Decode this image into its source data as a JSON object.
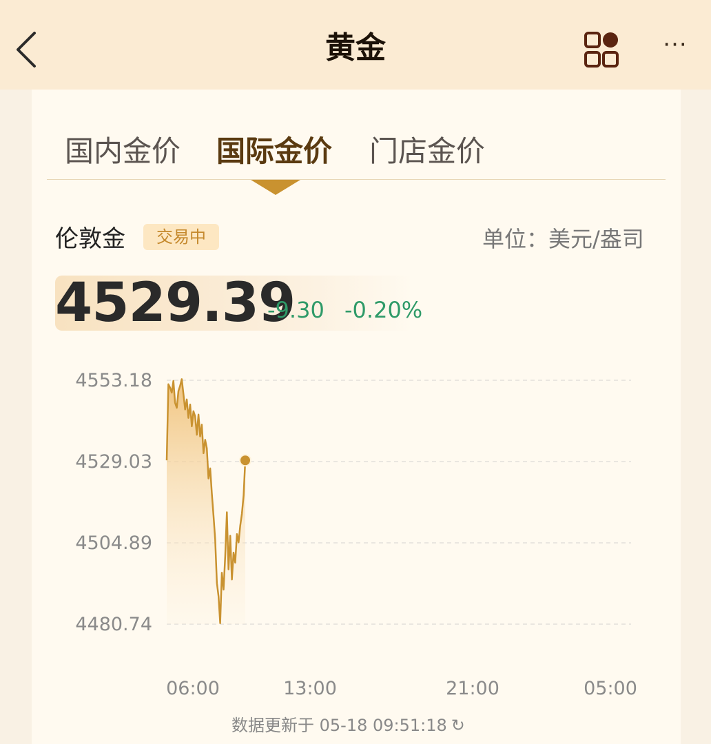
{
  "header": {
    "title": "黄金",
    "more_label": "···"
  },
  "tabs": [
    {
      "label": "国内金价",
      "active": false
    },
    {
      "label": "国际金价",
      "active": true
    },
    {
      "label": "门店金价",
      "active": false
    }
  ],
  "quote": {
    "name": "伦敦金",
    "status": "交易中",
    "unit": "单位：美元/盎司",
    "price": "4529.39",
    "change": "-9.30",
    "change_pct": "-0.20%"
  },
  "colors": {
    "accent": "#c99230",
    "down": "#2e9a68",
    "header_bg": "#fbebd3"
  },
  "footer": {
    "updated": "数据更新于 05-18 09:51:18",
    "refresh_icon": "refresh-icon"
  },
  "chart_data": {
    "type": "area",
    "y_ticks": [
      "4553.18",
      "4529.03",
      "4504.89",
      "4480.74"
    ],
    "x_ticks": [
      "06:00",
      "13:00",
      "21:00",
      "05:00"
    ],
    "ylim": [
      4480.74,
      4553.18
    ],
    "grid": true,
    "series": [
      {
        "values": [
          4529.4,
          4552.0,
          4551.0,
          4549.5,
          4553.0,
          4546.5,
          4545.0,
          4550.0,
          4551.5,
          4553.5,
          4549.0,
          4544.5,
          4547.5,
          4542.0,
          4546.0,
          4539.5,
          4544.0,
          4542.5,
          4537.0,
          4543.0,
          4536.5,
          4540.0,
          4531.5,
          4535.5,
          4533.0,
          4524.0,
          4527.0,
          4519.5,
          4513.0,
          4506.0,
          4493.0,
          4489.0,
          4481.0,
          4496.0,
          4491.0,
          4501.0,
          4514.0,
          4497.0,
          4507.0,
          4494.0,
          4502.0,
          4499.0,
          4507.5,
          4505.0,
          4510.0,
          4513.5,
          4519.0,
          4529.39
        ],
        "last_value": 4529.39
      }
    ]
  }
}
